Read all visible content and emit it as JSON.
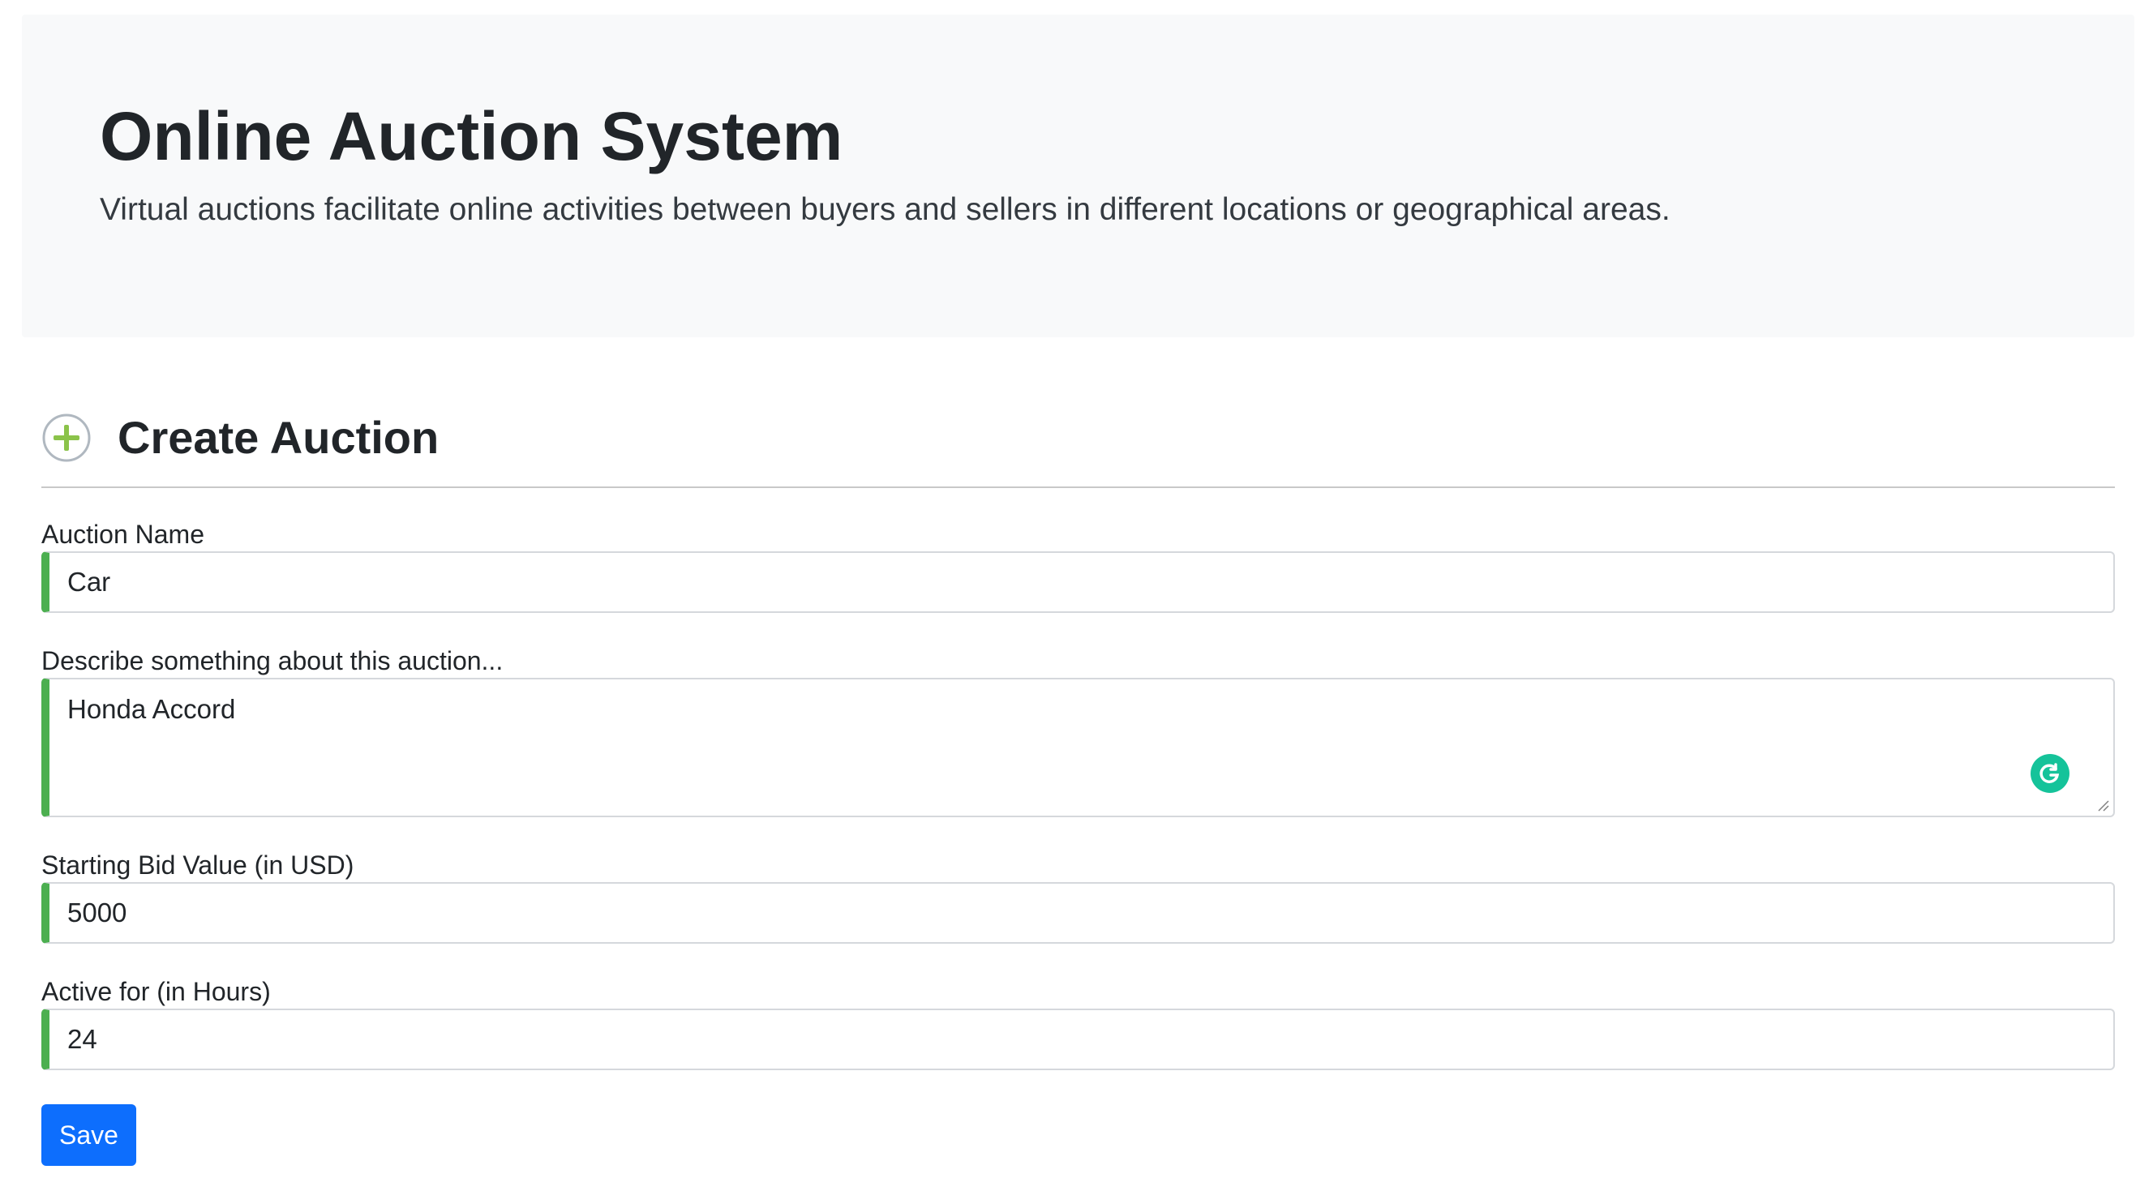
{
  "header": {
    "title": "Online Auction System",
    "lead": "Virtual auctions facilitate online activities between buyers and sellers in different locations or geographical areas."
  },
  "section": {
    "icon": "plus-circle-icon",
    "title": "Create Auction"
  },
  "form": {
    "auction_name": {
      "label": "Auction Name",
      "value": "Car"
    },
    "description": {
      "label": "Describe something about this auction...",
      "value": "Honda Accord"
    },
    "starting_bid": {
      "label": "Starting Bid Value (in USD)",
      "value": "5000"
    },
    "active_for": {
      "label": "Active for (in Hours)",
      "value": "24"
    },
    "save_label": "Save"
  },
  "colors": {
    "jumbotron_bg": "#f8f9fa",
    "valid_border": "#4caf50",
    "primary": "#0d6efd",
    "icon_green": "#8bc34a",
    "grammarly": "#15c39a"
  }
}
